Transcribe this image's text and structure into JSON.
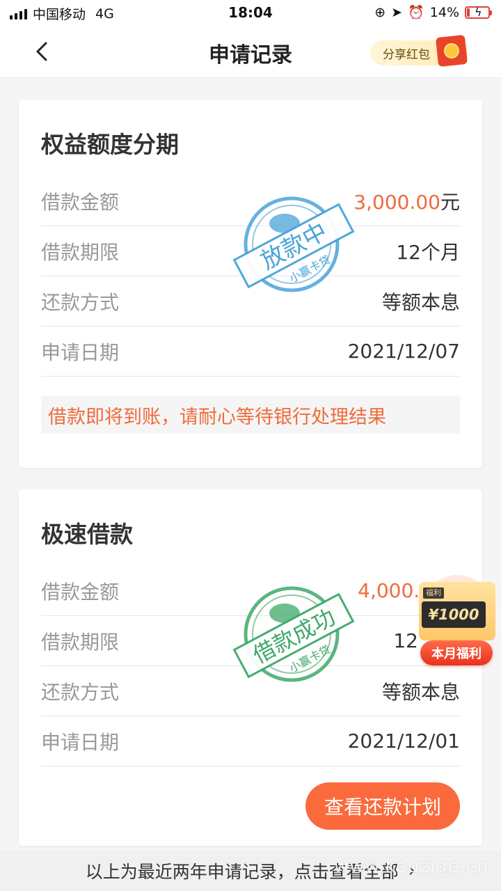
{
  "status_bar": {
    "carrier": "中国移动",
    "network": "4G",
    "time": "18:04",
    "battery": "14%",
    "battery_level": 0.14
  },
  "nav": {
    "title": "申请记录",
    "share_label": "分享红包"
  },
  "card1": {
    "title": "权益额度分期",
    "rows": [
      {
        "label": "借款金额",
        "value": "3,000.00",
        "unit": "元"
      },
      {
        "label": "借款期限",
        "value": "12个月"
      },
      {
        "label": "还款方式",
        "value": "等额本息"
      },
      {
        "label": "申请日期",
        "value": "2021/12/07"
      }
    ],
    "notice": "借款即将到账，请耐心等待银行处理结果",
    "stamp": {
      "text": "放款中",
      "sub": "小赢卡贷",
      "color": "#4aa3d8"
    }
  },
  "card2": {
    "title": "极速借款",
    "rows": [
      {
        "label": "借款金额",
        "value": "4,000.0"
      },
      {
        "label": "借款期限",
        "value": "12"
      },
      {
        "label": "还款方式",
        "value": "等额本息"
      },
      {
        "label": "申请日期",
        "value": "2021/12/01"
      }
    ],
    "repay_button": "查看还款计划",
    "stamp": {
      "text": "借款成功",
      "sub": "小赢卡贷",
      "color": "#3fa86a"
    }
  },
  "welfare": {
    "tag": "福利",
    "amount": "¥1000",
    "label": "本月福利"
  },
  "footer": {
    "text": "以上为最近两年申请记录，点击查看全部",
    "watermark": "www.kouzige.cn"
  },
  "colors": {
    "accent": "#fa6a3c",
    "amount": "#ef6b3b",
    "stamp_blue": "#4aa3d8",
    "stamp_green": "#3fa86a"
  }
}
